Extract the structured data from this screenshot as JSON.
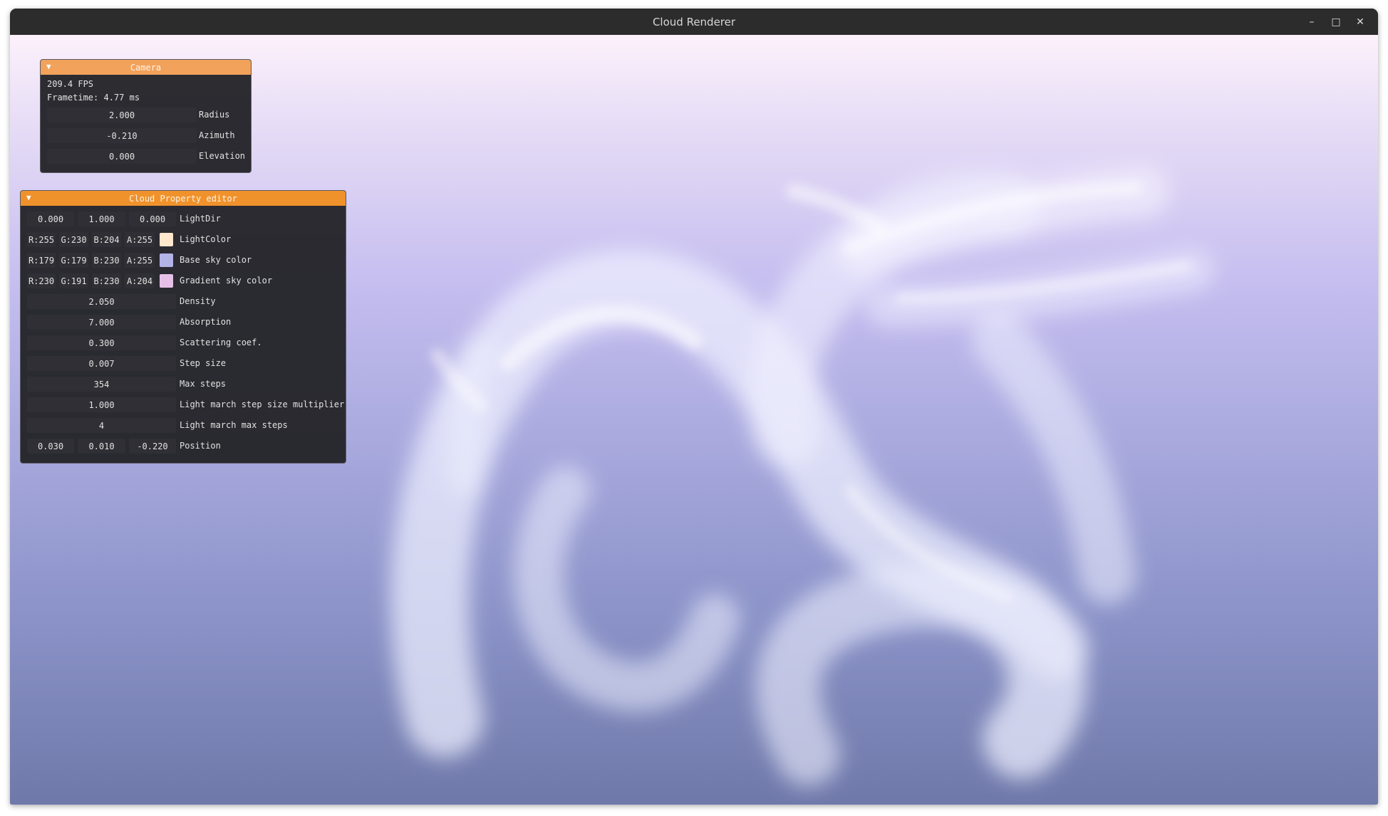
{
  "window": {
    "title": "Cloud Renderer",
    "minimize": "–",
    "maximize": "□",
    "close": "✕"
  },
  "camera_panel": {
    "title": "Camera",
    "fps": "209.4 FPS",
    "frametime": "Frametime: 4.77 ms",
    "rows": [
      {
        "value": "2.000",
        "label": "Radius"
      },
      {
        "value": "-0.210",
        "label": "Azimuth"
      },
      {
        "value": "0.000",
        "label": "Elevation"
      }
    ]
  },
  "cloud_panel": {
    "title": "Cloud Property editor",
    "light_dir": {
      "x": "0.000",
      "y": "1.000",
      "z": "0.000",
      "label": "LightDir"
    },
    "light_color": {
      "r": "R:255",
      "g": "G:230",
      "b": "B:204",
      "a": "A:255",
      "label": "LightColor",
      "swatch": "#ffe6cc"
    },
    "base_sky": {
      "r": "R:179",
      "g": "G:179",
      "b": "B:230",
      "a": "A:255",
      "label": "Base sky color",
      "swatch": "#b3b3e6"
    },
    "gradient_sky": {
      "r": "R:230",
      "g": "G:191",
      "b": "B:230",
      "a": "A:204",
      "label": "Gradient sky color",
      "swatch": "#e6bfe6"
    },
    "density": {
      "value": "2.050",
      "label": "Density"
    },
    "absorption": {
      "value": "7.000",
      "label": "Absorption"
    },
    "scattering": {
      "value": "0.300",
      "label": "Scattering coef."
    },
    "step_size": {
      "value": "0.007",
      "label": "Step size"
    },
    "max_steps": {
      "value": "354",
      "label": "Max steps"
    },
    "light_mult": {
      "value": "1.000",
      "label": "Light march step size multiplier"
    },
    "light_max_steps": {
      "value": "4",
      "label": "Light march max steps"
    },
    "position": {
      "x": "0.030",
      "y": "0.010",
      "z": "-0.220",
      "label": "Position"
    }
  },
  "colors": {
    "accent": "#f0922c",
    "panel_bg": "#25252a",
    "field_bg": "#2f2f35",
    "sky_top": "#fcf1fb",
    "sky_bottom": "#6f79a9"
  },
  "icons": {
    "collapse": "triangle-down-icon"
  }
}
